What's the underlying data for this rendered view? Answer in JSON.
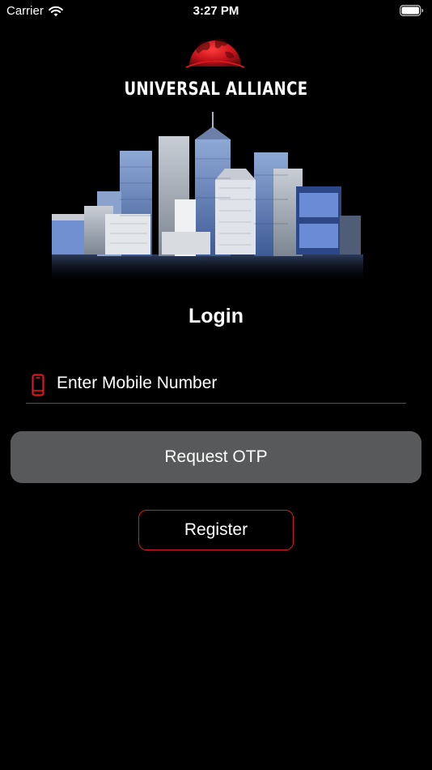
{
  "status_bar": {
    "carrier": "Carrier",
    "time": "3:27 PM",
    "wifi_icon": "wifi-icon",
    "battery_icon": "battery-icon"
  },
  "brand": {
    "name": "UNIVERSAL ALLIANCE",
    "logo_icon": "globe-logo",
    "accent_color": "#d71920"
  },
  "login": {
    "title": "Login",
    "mobile_placeholder": "Enter Mobile Number",
    "mobile_value": "",
    "phone_icon": "phone-icon",
    "request_otp_label": "Request OTP",
    "register_label": "Register"
  },
  "colors": {
    "background": "#000000",
    "button_gray": "#58595b",
    "accent_red": "#d71920",
    "text": "#ffffff"
  }
}
